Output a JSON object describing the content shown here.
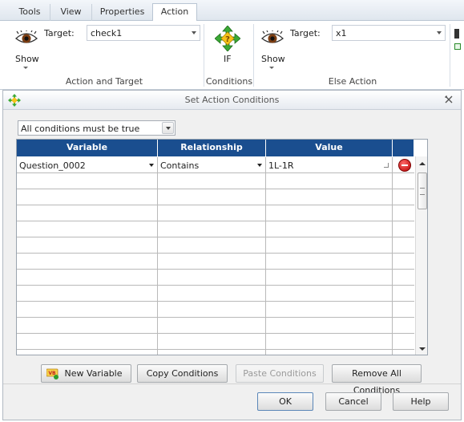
{
  "ribbon": {
    "tabs": [
      "Tools",
      "View",
      "Properties",
      "Action"
    ],
    "active_tab": "Action",
    "action_and_target": {
      "show_label": "Show",
      "target_label": "Target:",
      "target_value": "check1",
      "group_label": "Action and Target"
    },
    "conditions": {
      "if_label": "IF",
      "group_label": "Conditions"
    },
    "else_action": {
      "show_label": "Show",
      "target_label": "Target:",
      "target_value": "x1",
      "group_label": "Else Action"
    }
  },
  "dialog": {
    "title": "Set Action Conditions",
    "condition_mode": "All conditions must be true",
    "columns": [
      "Variable",
      "Relationship",
      "Value"
    ],
    "rows": [
      {
        "variable": "Question_0002",
        "relationship": "Contains",
        "value": "1L-1R"
      }
    ],
    "empty_row_count": 12,
    "buttons": {
      "new_variable": "New Variable",
      "copy_conditions": "Copy Conditions",
      "paste_conditions": "Paste Conditions",
      "remove_all": "Remove All Conditions",
      "ok": "OK",
      "cancel": "Cancel",
      "help": "Help"
    }
  },
  "colors": {
    "header_blue": "#1a4e8f",
    "remove_red": "#c00000"
  }
}
